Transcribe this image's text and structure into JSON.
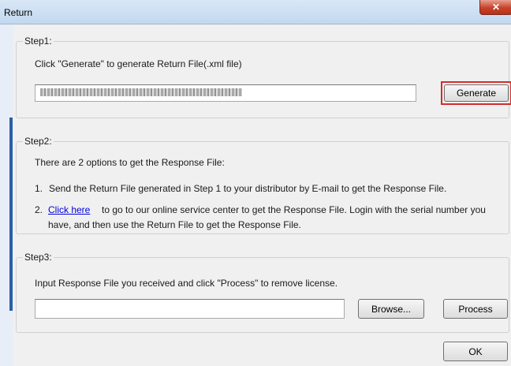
{
  "window": {
    "title": "Return",
    "close_glyph": "✕"
  },
  "step1": {
    "legend": "Step1:",
    "instruction": "Click \"Generate\" to generate Return File(.xml file)",
    "return_code_value": "",
    "generate_label": "Generate"
  },
  "step2": {
    "legend": "Step2:",
    "intro": "There are 2 options to get the Response File:",
    "option1_number": "1.",
    "option1_text": "Send the Return File generated in Step 1 to your distributor by E-mail to get the Response File.",
    "option2_number": "2.",
    "option2_link": "Click here",
    "option2_text_line1": "to go to our online service center to get the Response File. Login with the serial number you",
    "option2_text_line2": "have, and then use the Return File to get the Response File."
  },
  "step3": {
    "legend": "Step3:",
    "instruction": "Input Response File you received and click \"Process\" to remove license.",
    "response_file_value": "",
    "browse_label": "Browse...",
    "process_label": "Process"
  },
  "footer": {
    "ok_label": "OK"
  },
  "colors": {
    "highlight": "#d62b2b",
    "link": "#0000e0"
  }
}
